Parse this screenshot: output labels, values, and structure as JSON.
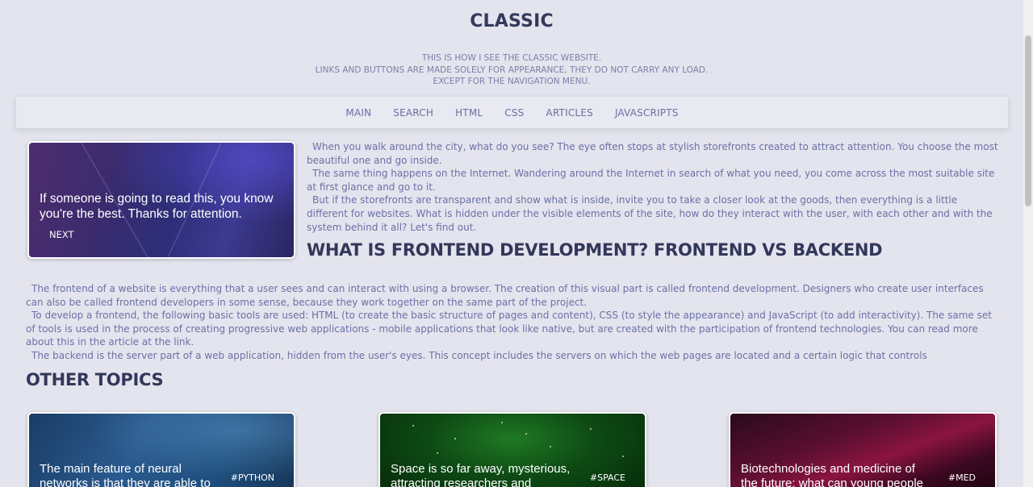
{
  "header": {
    "title": "CLASSIC",
    "intro_lines": [
      "THIS IS HOW I SEE THE CLASSIC WEBSITE.",
      "LINKS AND BUTTONS ARE MADE SOLELY FOR APPEARANCE, THEY DO NOT CARRY ANY LOAD.",
      "EXCEPT FOR THE NAVIGATION MENU."
    ]
  },
  "nav": {
    "items": [
      "MAIN",
      "SEARCH",
      "HTML",
      "CSS",
      "ARTICLES",
      "JAVASCRIPTS"
    ]
  },
  "hero": {
    "text": "If someone is going to read this, you know you're the best. Thanks for attention.",
    "next_label": "NEXT"
  },
  "intro_paragraphs": [
    "When you walk around the city, what do you see? The eye often stops at stylish storefronts created to attract attention. You choose the most beautiful one and go inside.",
    "The same thing happens on the Internet. Wandering around the Internet in search of what you need, you come across the most suitable site at first glance and go to it.",
    "But if the storefronts are transparent and show what is inside, invite you to take a closer look at the goods, then everything is a little different for websites. What is hidden under the visible elements of the site, how do they interact with the user, with each other and with the system behind it all? Let's find out."
  ],
  "article": {
    "title": "WHAT IS FRONTEND DEVELOPMENT? FRONTEND VS BACKEND",
    "paragraphs": [
      "The frontend of a website is everything that a user sees and can interact with using a browser. The creation of this visual part is called frontend development. Designers who create user interfaces can also be called frontend developers in some sense, because they work together on the same part of the project.",
      "To develop a frontend, the following basic tools are used: HTML (to create the basic structure of pages and content), CSS (to style the appearance) and JavaScript (to add interactivity). The same set of tools is used in the process of creating progressive web applications - mobile applications that look like native, but are created with the participation of frontend technologies. You can read more about this in the article at the link.",
      "The backend is the server part of a web application, hidden from the user's eyes. This concept includes the servers on which the web pages are located and a certain logic that controls"
    ]
  },
  "other_topics": {
    "title": "OTHER TOPICS",
    "cards": [
      {
        "title": "The main feature of neural networks is that they are able to",
        "tag": "#PYTHON"
      },
      {
        "title": "Space is so far away, mysterious, attracting researchers and",
        "tag": "#SPACE"
      },
      {
        "title": "Biotechnologies and medicine of the future: what can young people",
        "tag": "#MED"
      }
    ]
  }
}
